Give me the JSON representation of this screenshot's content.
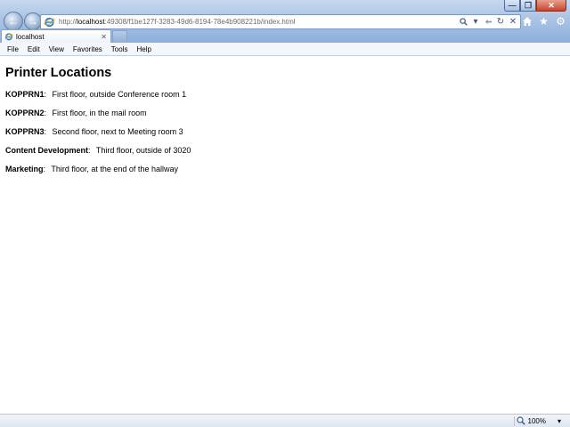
{
  "browser": {
    "url_prefix": "http://",
    "url_host": "localhost",
    "url_rest": ":49308/f1be127f-3283-49d6-8194-78e4b908221b/index.html",
    "tab_label": "localhost",
    "tab_close": "✕",
    "menu": [
      "File",
      "Edit",
      "View",
      "Favorites",
      "Tools",
      "Help"
    ],
    "zoom": "100%",
    "accent": "#8db0dc"
  },
  "page": {
    "title": "Printer Locations",
    "locations": [
      {
        "printer": "KOPPRN1",
        "separator": ":",
        "description": "First floor, outside Conference room 1"
      },
      {
        "printer": "KOPPRN2",
        "separator": ":",
        "description": "First floor, in the mail room"
      },
      {
        "printer": "KOPPRN3",
        "separator": ":",
        "description": "Second floor, next to Meeting room 3"
      },
      {
        "printer": "Content Development",
        "separator": ":",
        "description": "Third floor, outside of 3020"
      },
      {
        "printer": "Marketing",
        "separator": ":",
        "description": "Third floor, at the end of the hallway"
      }
    ]
  }
}
